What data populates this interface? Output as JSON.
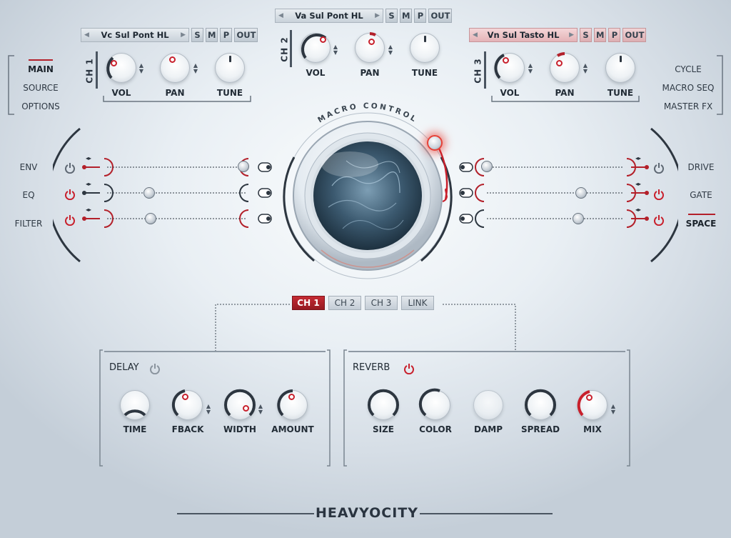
{
  "channels": [
    {
      "id": "ch1",
      "label": "CH 1",
      "patch": "Vc Sul Pont HL",
      "buttons": [
        "S",
        "M",
        "P",
        "OUT"
      ],
      "knobs": [
        "VOL",
        "PAN",
        "TUNE"
      ]
    },
    {
      "id": "ch2",
      "label": "CH 2",
      "patch": "Va Sul Pont HL",
      "buttons": [
        "S",
        "M",
        "P",
        "OUT"
      ],
      "knobs": [
        "VOL",
        "PAN",
        "TUNE"
      ]
    },
    {
      "id": "ch3",
      "label": "CH 3",
      "patch": "Vn Sul Tasto HL",
      "buttons": [
        "S",
        "M",
        "P",
        "OUT"
      ],
      "knobs": [
        "VOL",
        "PAN",
        "TUNE"
      ]
    }
  ],
  "left_menu": [
    "MAIN",
    "SOURCE",
    "OPTIONS"
  ],
  "right_menu": [
    "CYCLE",
    "MACRO SEQ",
    "MASTER FX"
  ],
  "macro_title": "MACRO CONTROL",
  "left_fx": [
    "ENV",
    "EQ",
    "FILTER"
  ],
  "right_fx": [
    "DRIVE",
    "GATE",
    "SPACE"
  ],
  "tabs": [
    "CH 1",
    "CH 2",
    "CH 3",
    "LINK"
  ],
  "delay": {
    "title": "DELAY",
    "knobs": [
      "TIME",
      "FBACK",
      "WIDTH",
      "AMOUNT"
    ]
  },
  "reverb": {
    "title": "REVERB",
    "knobs": [
      "SIZE",
      "COLOR",
      "DAMP",
      "SPREAD",
      "MIX"
    ]
  },
  "brand": "HEAVYOCITY",
  "colors": {
    "accent": "#c8202c",
    "panel": "#eef2f5",
    "text": "#222c36"
  }
}
